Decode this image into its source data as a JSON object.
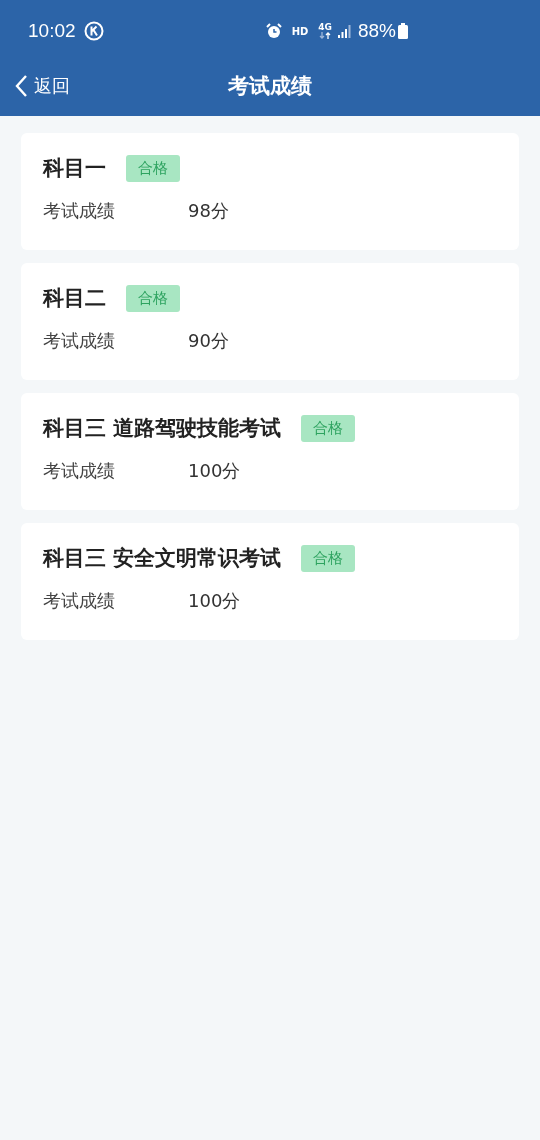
{
  "status_bar": {
    "time": "10:02",
    "hd": "HD",
    "network": "4G",
    "battery": "88%"
  },
  "nav_bar": {
    "back": "返回",
    "title": "考试成绩"
  },
  "results": [
    {
      "subject": "科目一",
      "badge": "合格",
      "label": "考试成绩",
      "score": "98分"
    },
    {
      "subject": "科目二",
      "badge": "合格",
      "label": "考试成绩",
      "score": "90分"
    },
    {
      "subject": "科目三 道路驾驶技能考试",
      "badge": "合格",
      "label": "考试成绩",
      "score": "100分"
    },
    {
      "subject": "科目三 安全文明常识考试",
      "badge": "合格",
      "label": "考试成绩",
      "score": "100分"
    }
  ]
}
